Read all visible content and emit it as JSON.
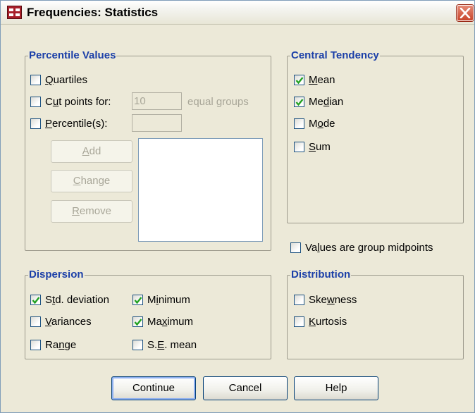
{
  "window": {
    "title": "Frequencies: Statistics"
  },
  "percentile_values": {
    "legend": "Percentile Values",
    "quartiles": {
      "label_pre": "",
      "label_u": "Q",
      "label_post": "uartiles",
      "checked": false
    },
    "cut_points": {
      "label_pre": "C",
      "label_u": "u",
      "label_post": "t points for:",
      "checked": false,
      "value": "10",
      "suffix": "equal groups"
    },
    "percentiles": {
      "label_pre": "",
      "label_u": "P",
      "label_post": "ercentile(s):",
      "checked": false,
      "value": ""
    },
    "buttons": {
      "add": {
        "pre": "",
        "u": "A",
        "post": "dd"
      },
      "change": {
        "pre": "",
        "u": "C",
        "post": "hange"
      },
      "remove": {
        "pre": "",
        "u": "R",
        "post": "emove"
      }
    }
  },
  "central_tendency": {
    "legend": "Central Tendency",
    "mean": {
      "label_pre": "",
      "label_u": "M",
      "label_post": "ean",
      "checked": true
    },
    "median": {
      "label_pre": "Me",
      "label_u": "d",
      "label_post": "ian",
      "checked": true
    },
    "mode": {
      "label_pre": "M",
      "label_u": "o",
      "label_post": "de",
      "checked": false
    },
    "sum": {
      "label_pre": "",
      "label_u": "S",
      "label_post": "um",
      "checked": false
    }
  },
  "midpoints": {
    "label_pre": "Va",
    "label_u": "l",
    "label_post": "ues are group midpoints",
    "checked": false
  },
  "dispersion": {
    "legend": "Dispersion",
    "std_deviation": {
      "label_pre": "S",
      "label_u": "t",
      "label_post": "d. deviation",
      "checked": true
    },
    "minimum": {
      "label_pre": "M",
      "label_u": "i",
      "label_post": "nimum",
      "checked": true
    },
    "variances": {
      "label_pre": "",
      "label_u": "V",
      "label_post": "ariances",
      "checked": false
    },
    "maximum": {
      "label_pre": "Ma",
      "label_u": "x",
      "label_post": "imum",
      "checked": true
    },
    "range": {
      "label_pre": "Ra",
      "label_u": "n",
      "label_post": "ge",
      "checked": false
    },
    "se_mean": {
      "label_pre": "S.",
      "label_u": "E",
      "label_post": ". mean",
      "checked": false
    }
  },
  "distribution": {
    "legend": "Distribution",
    "skewness": {
      "label_pre": "Ske",
      "label_u": "w",
      "label_post": "ness",
      "checked": false
    },
    "kurtosis": {
      "label_pre": "",
      "label_u": "K",
      "label_post": "urtosis",
      "checked": false
    }
  },
  "footer": {
    "continue_label": "Continue",
    "cancel_label": "Cancel",
    "help_label": "Help"
  },
  "colors": {
    "legend": "#1b3fa8",
    "dialog_bg": "#ece9d8",
    "check": "#21a121",
    "close": "#c8452b"
  },
  "icons": {
    "app": "spss-table-icon",
    "close": "close-x-icon",
    "check": "checkmark-icon"
  }
}
